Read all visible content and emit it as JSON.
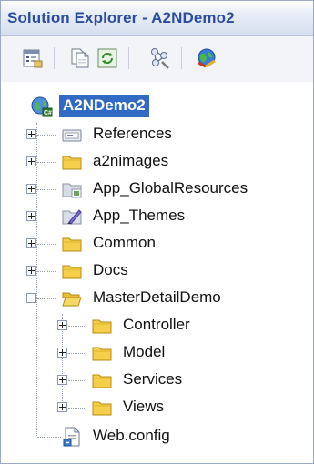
{
  "window": {
    "title": "Solution Explorer - A2NDemo2"
  },
  "toolbar": {
    "buttons": [
      {
        "name": "properties-icon"
      },
      {
        "name": "show-all-files-icon"
      },
      {
        "name": "refresh-icon"
      },
      {
        "name": "copy-website-icon"
      },
      {
        "name": "aspnet-configuration-icon"
      }
    ]
  },
  "tree": {
    "root": {
      "label": "A2NDemo2",
      "icon": "web-project-icon"
    },
    "items": [
      {
        "label": "References",
        "icon": "references-icon",
        "expanded": false
      },
      {
        "label": "a2nimages",
        "icon": "folder-icon",
        "expanded": false
      },
      {
        "label": "App_GlobalResources",
        "icon": "global-resources-folder-icon",
        "expanded": false
      },
      {
        "label": "App_Themes",
        "icon": "themes-folder-icon",
        "expanded": false
      },
      {
        "label": "Common",
        "icon": "folder-icon",
        "expanded": false
      },
      {
        "label": "Docs",
        "icon": "folder-icon",
        "expanded": false
      },
      {
        "label": "MasterDetailDemo",
        "icon": "open-folder-icon",
        "expanded": true,
        "children": [
          {
            "label": "Controller",
            "icon": "folder-icon",
            "expanded": false
          },
          {
            "label": "Model",
            "icon": "folder-icon",
            "expanded": false
          },
          {
            "label": "Services",
            "icon": "folder-icon",
            "expanded": false
          },
          {
            "label": "Views",
            "icon": "folder-icon",
            "expanded": false
          }
        ]
      },
      {
        "label": "Web.config",
        "icon": "config-file-icon"
      }
    ]
  },
  "colors": {
    "title_text": "#2c4d9f",
    "selection": "#316ac5",
    "folder": "#f5cf4a"
  }
}
